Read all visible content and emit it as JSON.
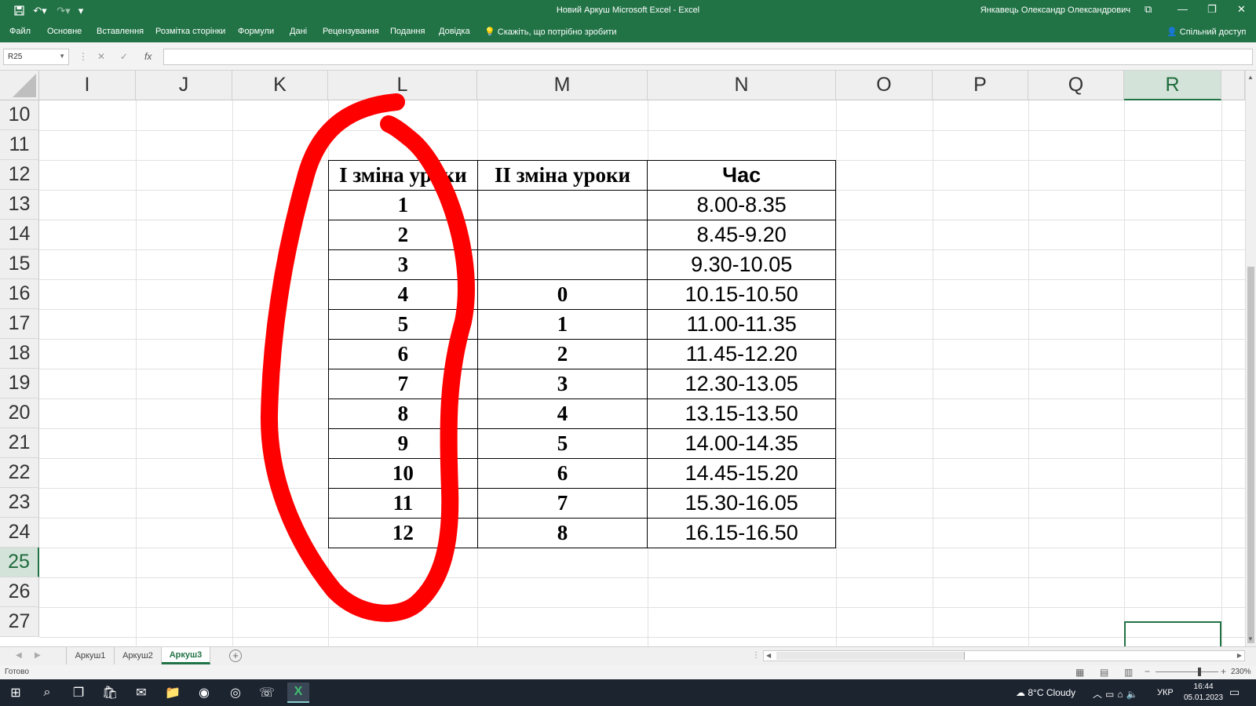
{
  "titlebar": {
    "title": "Новий Аркуш Microsoft Excel  -  Excel",
    "user": "Янкавець Олександр Олександрович",
    "qat": [
      "save-icon",
      "undo-icon",
      "redo-icon",
      "customize-icon"
    ]
  },
  "ribbon": {
    "tabs": [
      "Файл",
      "Основне",
      "Вставлення",
      "Розмітка сторінки",
      "Формули",
      "Дані",
      "Рецензування",
      "Подання",
      "Довідка"
    ],
    "tell_me": "Скажіть, що потрібно зробити",
    "share": "Спільний доступ"
  },
  "formula_bar": {
    "name_box": "R25",
    "fx": "fx",
    "value": ""
  },
  "grid": {
    "columns": [
      "I",
      "J",
      "K",
      "L",
      "M",
      "N",
      "O",
      "P",
      "Q",
      "R"
    ],
    "rows": [
      "10",
      "11",
      "12",
      "13",
      "14",
      "15",
      "16",
      "17",
      "18",
      "19",
      "20",
      "21",
      "22",
      "23",
      "24",
      "25",
      "26",
      "27"
    ],
    "selected_column": "R",
    "selected_row": "25",
    "accent": "#217346"
  },
  "table": {
    "headers": [
      "І зміна уроки",
      "ІІ зміна уроки",
      "Час"
    ],
    "rows": [
      [
        "1",
        "",
        "8.00-8.35"
      ],
      [
        "2",
        "",
        "8.45-9.20"
      ],
      [
        "3",
        "",
        "9.30-10.05"
      ],
      [
        "4",
        "0",
        "10.15-10.50"
      ],
      [
        "5",
        "1",
        "11.00-11.35"
      ],
      [
        "6",
        "2",
        "11.45-12.20"
      ],
      [
        "7",
        "3",
        "12.30-13.05"
      ],
      [
        "8",
        "4",
        "13.15-13.50"
      ],
      [
        "9",
        "5",
        "14.00-14.35"
      ],
      [
        "10",
        "6",
        "14.45-15.20"
      ],
      [
        "11",
        "7",
        "15.30-16.05"
      ],
      [
        "12",
        "8",
        "16.15-16.50"
      ]
    ]
  },
  "annotation": {
    "color": "#ff0000"
  },
  "sheets": {
    "tabs": [
      "Аркуш1",
      "Аркуш2",
      "Аркуш3"
    ],
    "active": "Аркуш3"
  },
  "status": {
    "ready": "Готово",
    "zoom": "230%"
  },
  "taskbar": {
    "weather": "8°C  Cloudy",
    "lang": "УКР",
    "time": "16:44",
    "date": "05.01.2023"
  }
}
